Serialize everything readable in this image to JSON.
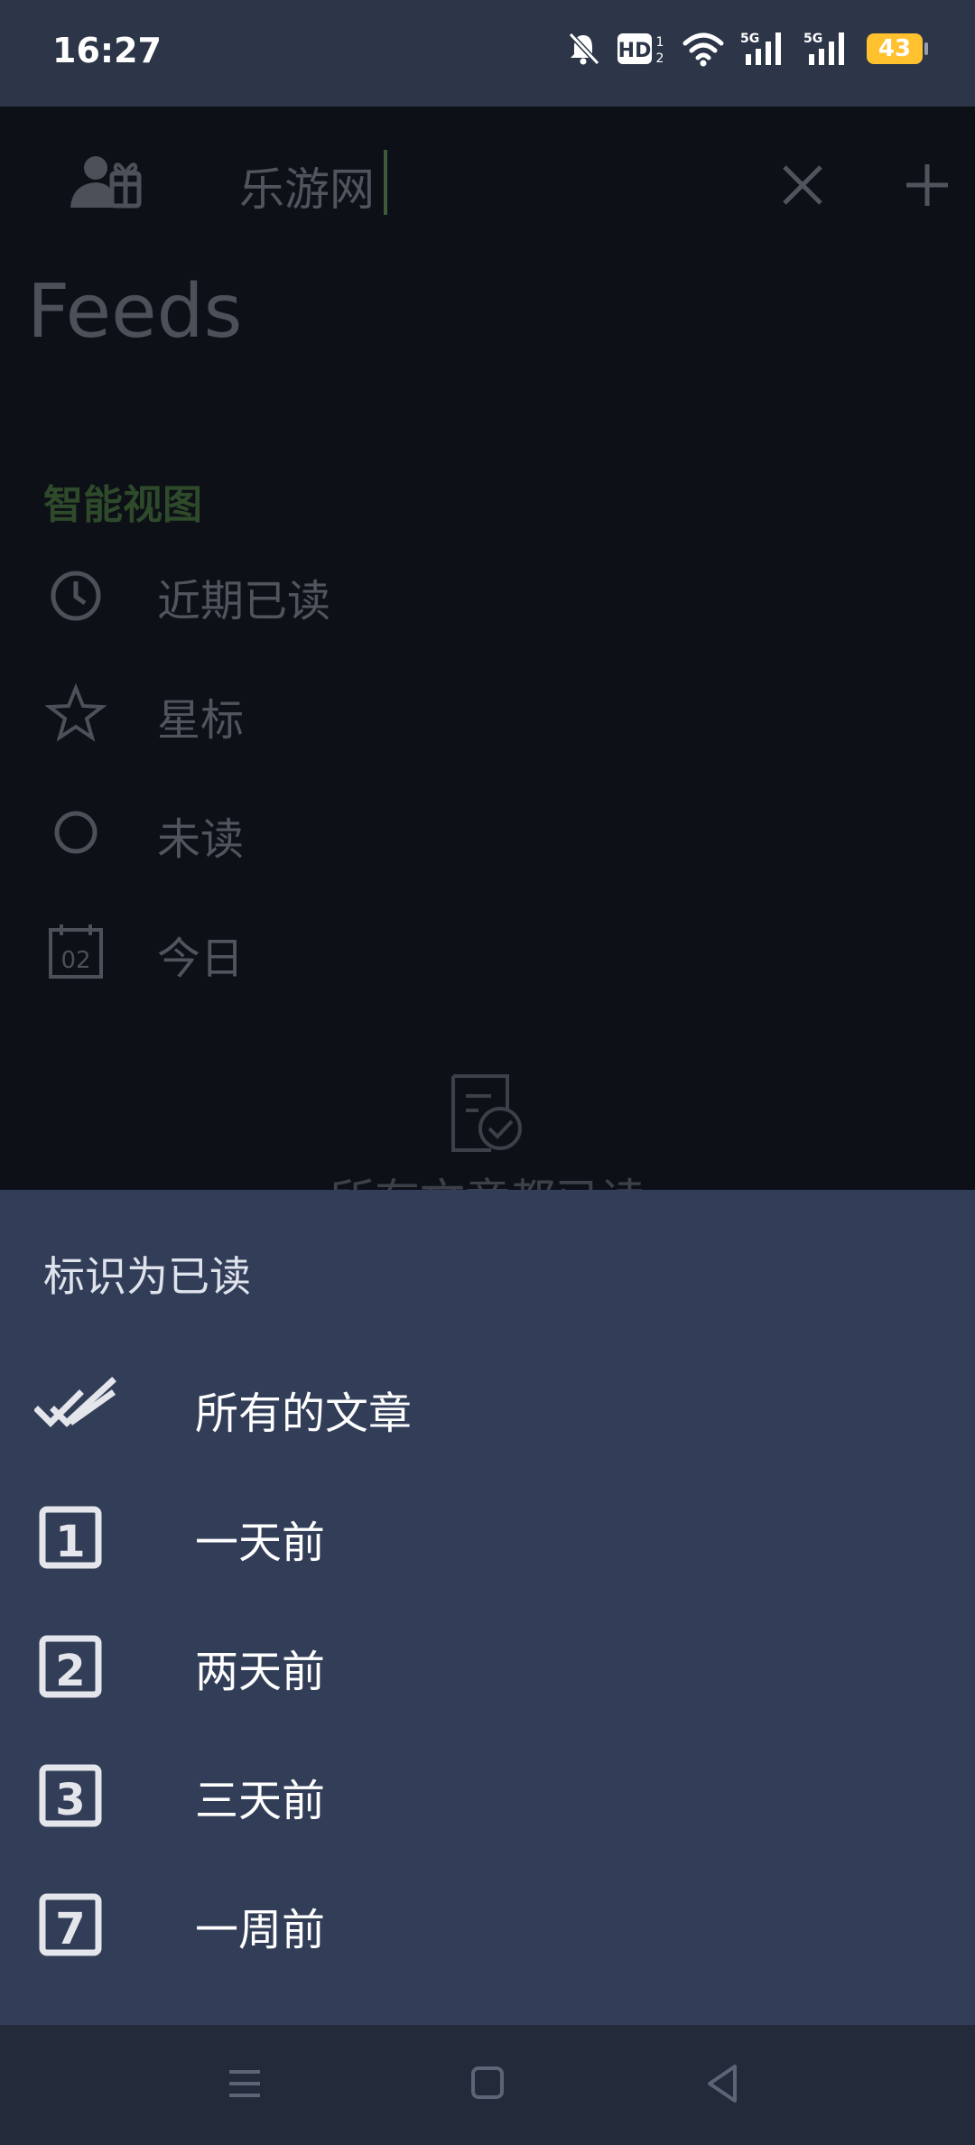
{
  "status_bar": {
    "time": "16:27",
    "battery": "43",
    "icons": [
      "bell-mute-icon",
      "hd-icon",
      "wifi-icon",
      "signal-5g-icon",
      "signal-5g-icon-2"
    ]
  },
  "background_app": {
    "search_value": "乐游网",
    "page_title": "Feeds",
    "section_label": "智能视图",
    "nav_items": [
      {
        "label": "近期已读",
        "icon": "clock-icon"
      },
      {
        "label": "星标",
        "icon": "star-icon"
      },
      {
        "label": "未读",
        "icon": "circle-icon"
      },
      {
        "label": "今日",
        "icon": "calendar-icon",
        "icon_text": "02"
      }
    ],
    "empty_text": "所有文章都已读"
  },
  "sheet": {
    "title": "标识为已读",
    "items": [
      {
        "label": "所有的文章",
        "icon": "double-check-icon"
      },
      {
        "label": "一天前",
        "icon": "one-box-icon",
        "icon_text": "1"
      },
      {
        "label": "两天前",
        "icon": "two-box-icon",
        "icon_text": "2"
      },
      {
        "label": "三天前",
        "icon": "three-box-icon",
        "icon_text": "3"
      },
      {
        "label": "一周前",
        "icon": "seven-box-icon",
        "icon_text": "7"
      }
    ]
  },
  "colors": {
    "status_bar_bg": "#2c3648",
    "sheet_bg": "#323d58",
    "nav_bar_bg": "#232a3a",
    "battery": "#ffc12e",
    "accent_green": "#2e4a2a"
  }
}
